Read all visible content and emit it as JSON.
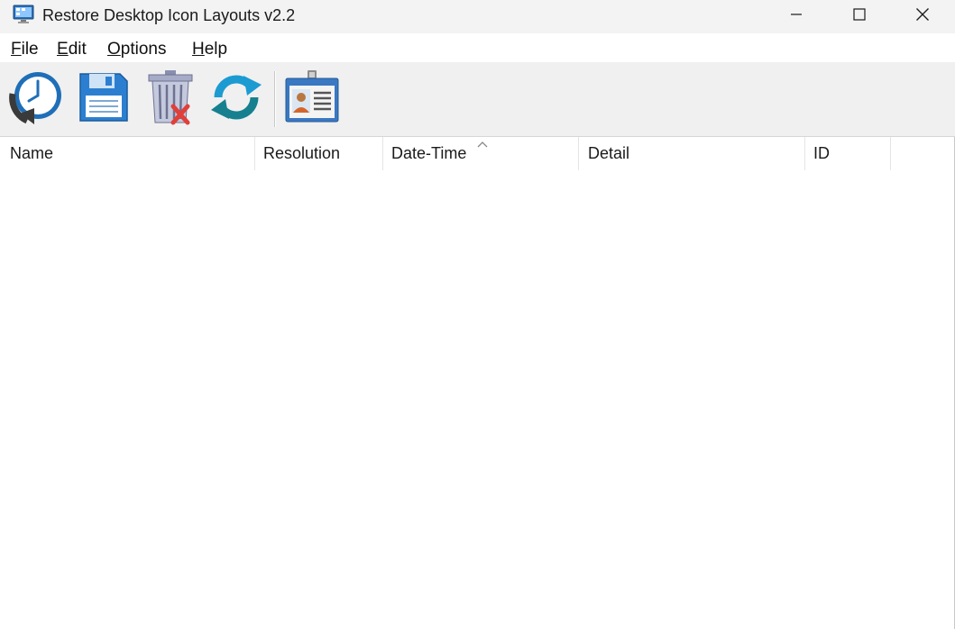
{
  "window": {
    "title": "Restore Desktop Icon Layouts v2.2",
    "app_icon": "desktop-monitor-icon"
  },
  "caption_buttons": {
    "minimize_icon": "minimize-icon",
    "maximize_icon": "maximize-icon",
    "close_icon": "close-icon"
  },
  "menu": {
    "items": [
      {
        "label_acc": "F",
        "label_rest": "ile"
      },
      {
        "label_acc": "E",
        "label_rest": "dit"
      },
      {
        "label_acc": "O",
        "label_rest": "ptions"
      },
      {
        "label_acc": "H",
        "label_rest": "elp"
      }
    ]
  },
  "toolbar": {
    "buttons": [
      {
        "icon": "restore-clock-icon"
      },
      {
        "icon": "save-floppy-icon"
      },
      {
        "icon": "delete-trash-icon"
      },
      {
        "icon": "refresh-icon"
      },
      {
        "icon": "properties-id-card-icon"
      }
    ]
  },
  "list": {
    "columns": [
      {
        "label": "Name"
      },
      {
        "label": "Resolution"
      },
      {
        "label": "Date-Time"
      },
      {
        "label": "Detail"
      },
      {
        "label": "ID"
      }
    ],
    "sorted_column": "Date-Time",
    "sort_direction": "ascending",
    "rows": []
  },
  "colors": {
    "titlebar_bg": "#f3f3f3",
    "toolbar_bg": "#f0f0f0",
    "list_bg": "#ffffff"
  }
}
